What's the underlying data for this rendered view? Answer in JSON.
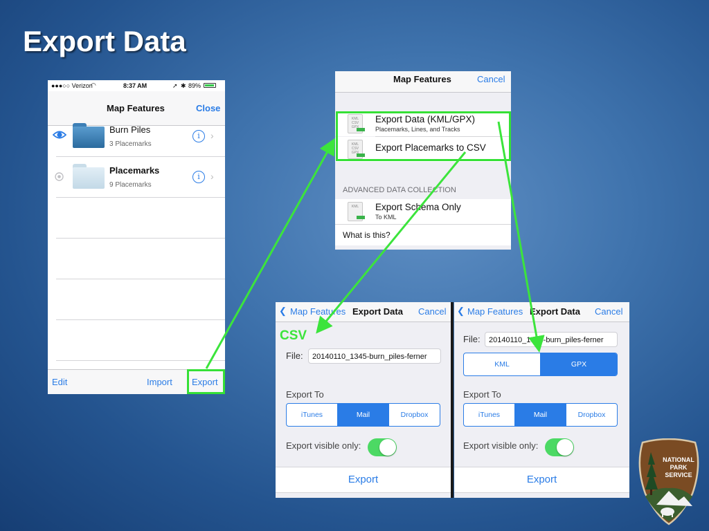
{
  "slide": {
    "title": "Export Data"
  },
  "colors": {
    "accent": "#2a7ce6",
    "highlight": "#35e036",
    "toggle_on": "#4cd964"
  },
  "phone1": {
    "status": {
      "carrier": "●●●○○ Verizon",
      "time": "8:37 AM",
      "battery": "89%"
    },
    "nav": {
      "title": "Map Features",
      "right": "Close"
    },
    "rows": [
      {
        "title": "Burn Piles",
        "subtitle": "3 Placemarks",
        "visibility_icon": "eye-icon"
      },
      {
        "title": "Placemarks",
        "subtitle": "9 Placemarks",
        "visibility_icon": "hidden-icon"
      }
    ],
    "toolbar": {
      "edit": "Edit",
      "import": "Import",
      "export": "Export"
    }
  },
  "screen2": {
    "nav": {
      "title": "Map Features",
      "right": "Cancel"
    },
    "items": [
      {
        "title": "Export Data (KML/GPX)",
        "subtitle": "Placemarks, Lines, and Tracks",
        "icon_text": "KML CSV GPX"
      },
      {
        "title": "Export Placemarks to CSV",
        "icon_text": "KML CSV GPX"
      }
    ],
    "section": "ADVANCED DATA COLLECTION",
    "schema": {
      "title": "Export Schema Only",
      "subtitle": "To KML",
      "icon_text": "KML"
    },
    "what": "What is this?"
  },
  "csv_screen": {
    "tag": "CSV",
    "nav": {
      "back": "Map Features",
      "title": "Export Data",
      "right": "Cancel"
    },
    "file_label": "File:",
    "file_value": "20140110_1345-burn_piles-ferner",
    "export_to_label": "Export To",
    "export_to": [
      "iTunes",
      "Mail",
      "Dropbox"
    ],
    "export_to_selected": "Mail",
    "visible_only_label": "Export visible only:",
    "visible_only": true,
    "export_button": "Export"
  },
  "gpx_screen": {
    "nav": {
      "back": "Map Features",
      "title": "Export Data",
      "right": "Cancel"
    },
    "file_label": "File:",
    "file_value": "20140110_1345-burn_piles-ferner",
    "format": [
      "KML",
      "GPX"
    ],
    "format_selected": "GPX",
    "export_to_label": "Export To",
    "export_to": [
      "iTunes",
      "Mail",
      "Dropbox"
    ],
    "export_to_selected": "Mail",
    "visible_only_label": "Export visible only:",
    "visible_only": true,
    "export_button": "Export"
  },
  "logo": {
    "lines": [
      "NATIONAL",
      "PARK",
      "SERVICE"
    ]
  }
}
